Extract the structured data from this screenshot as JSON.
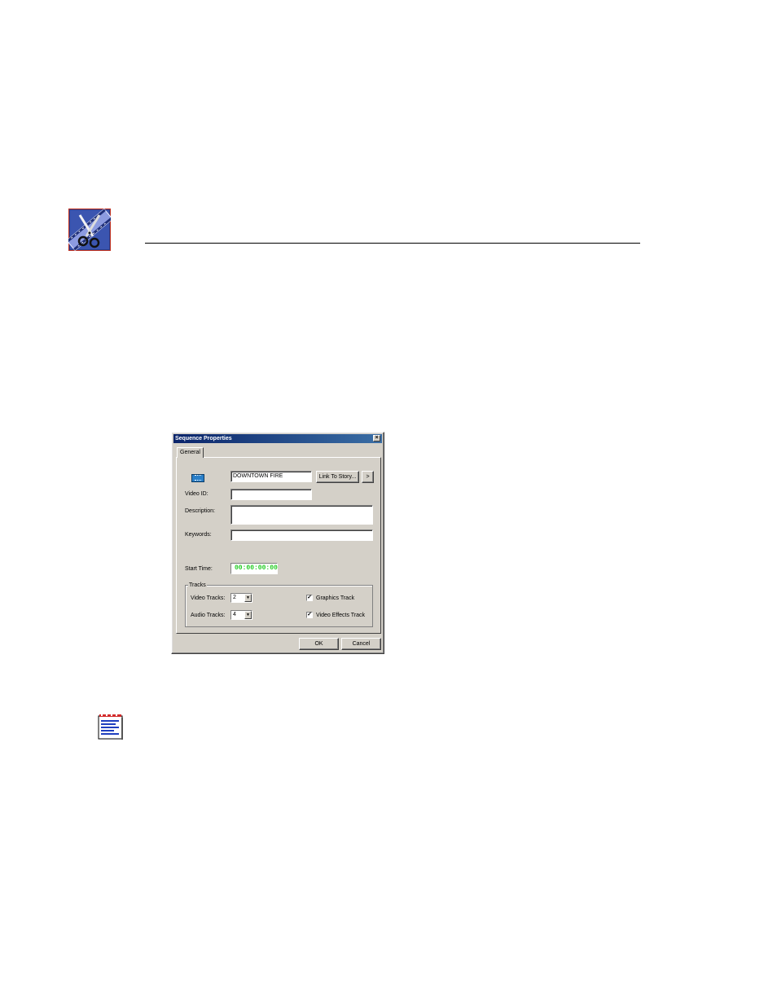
{
  "dialog": {
    "title": "Sequence Properties",
    "close_glyph": "×",
    "tabs": [
      {
        "label": "General"
      }
    ],
    "name_value": "DOWNTOWN FIRE",
    "link_button": "Link To Story...",
    "arrow_button": ">",
    "video_id_label": "Video ID:",
    "video_id_value": "",
    "description_label": "Description:",
    "description_value": "",
    "keywords_label": "Keywords:",
    "keywords_value": "",
    "start_time_label": "Start Time:",
    "start_time_value": "00:00:00:00",
    "tracks": {
      "legend": "Tracks",
      "video_tracks_label": "Video Tracks:",
      "video_tracks_value": "2",
      "audio_tracks_label": "Audio Tracks:",
      "audio_tracks_value": "4",
      "graphics_track_label": "Graphics Track",
      "graphics_track_checked": true,
      "video_effects_track_label": "Video Effects Track",
      "video_effects_track_checked": true,
      "check_glyph": "✓",
      "dropdown_glyph": "▼"
    },
    "ok_button": "OK",
    "cancel_button": "Cancel"
  },
  "icons": {
    "header_logo": "film-scissors-logo-icon",
    "note": "note-list-icon"
  },
  "colors": {
    "title_bar": "#0a246a",
    "dialog_face": "#d4d0c8",
    "timecode_text": "#22cc22"
  }
}
